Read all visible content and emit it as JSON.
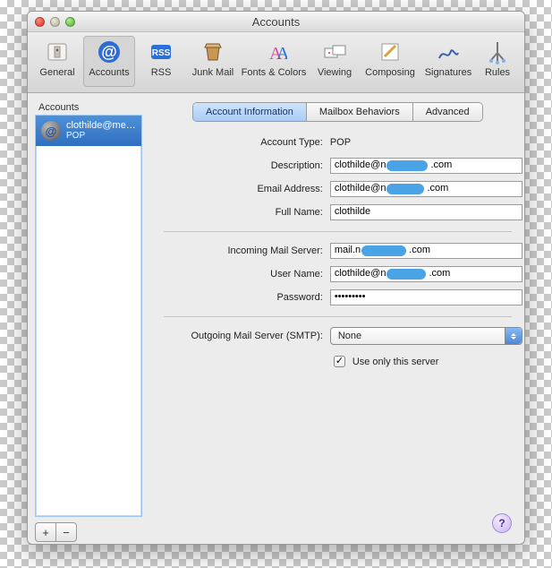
{
  "window": {
    "title": "Accounts"
  },
  "toolbar": {
    "items": [
      {
        "name": "general",
        "label": "General"
      },
      {
        "name": "accounts",
        "label": "Accounts"
      },
      {
        "name": "rss",
        "label": "RSS"
      },
      {
        "name": "junk",
        "label": "Junk Mail"
      },
      {
        "name": "fonts",
        "label": "Fonts & Colors"
      },
      {
        "name": "viewing",
        "label": "Viewing"
      },
      {
        "name": "composing",
        "label": "Composing"
      },
      {
        "name": "signatures",
        "label": "Signatures"
      },
      {
        "name": "rules",
        "label": "Rules"
      }
    ],
    "selected": "accounts"
  },
  "sidebar": {
    "heading": "Accounts",
    "accounts": [
      {
        "display": "clothilde@me…",
        "type": "POP"
      }
    ],
    "add": "+",
    "remove": "−"
  },
  "tabs": {
    "items": [
      {
        "label": "Account Information"
      },
      {
        "label": "Mailbox Behaviors"
      },
      {
        "label": "Advanced"
      }
    ],
    "selected": 0
  },
  "form": {
    "account_type_label": "Account Type:",
    "account_type_value": "POP",
    "description_label": "Description:",
    "description_value_prefix": "clothilde@n",
    "description_value_suffix": ".com",
    "email_label": "Email Address:",
    "email_value_prefix": "clothilde@n",
    "email_value_suffix": ".com",
    "fullname_label": "Full Name:",
    "fullname_value": "clothilde",
    "incoming_label": "Incoming Mail Server:",
    "incoming_prefix": "mail.n",
    "incoming_suffix": ".com",
    "username_label": "User Name:",
    "username_prefix": "clothilde@n",
    "username_suffix": ".com",
    "password_label": "Password:",
    "password_value": "•••••••••",
    "smtp_label": "Outgoing Mail Server (SMTP):",
    "smtp_value": "None",
    "useonly_label": "Use only this server",
    "useonly_checked": true
  },
  "help": "?"
}
